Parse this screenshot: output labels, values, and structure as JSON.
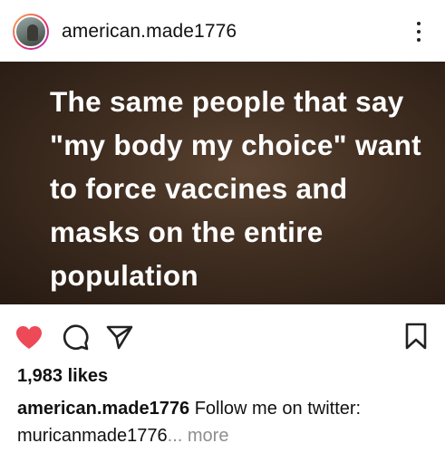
{
  "header": {
    "username": "american.made1776",
    "avatar_icon": "profile-photo",
    "menu_icon": "more-vertical-icon"
  },
  "post_image": {
    "text": "The same people that say \"my body my choice\" want to force vaccines and masks on the entire population",
    "background_color": "#3f2d20",
    "text_color": "#ffffff"
  },
  "actions": {
    "like_icon": "heart-icon",
    "liked": true,
    "like_color": "#ed4956",
    "comment_icon": "comment-icon",
    "share_icon": "send-icon",
    "save_icon": "bookmark-icon"
  },
  "likes": "1,983 likes",
  "caption": {
    "username": "american.made1776",
    "text": "Follow me on twitter: muricanmade1776",
    "truncation": "...",
    "more_label": "more"
  }
}
